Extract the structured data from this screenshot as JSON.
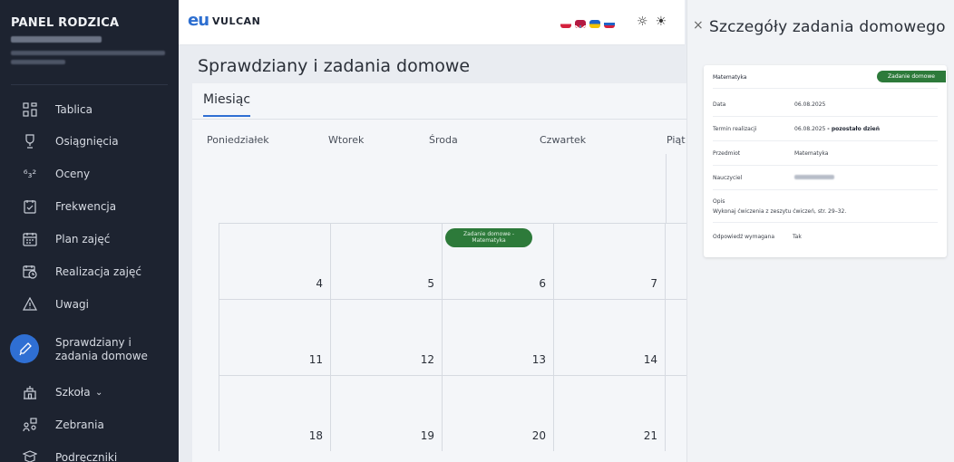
{
  "sidebar": {
    "title": "PANEL RODZICA",
    "items": [
      {
        "label": "Tablica",
        "icon": "dashboard-icon"
      },
      {
        "label": "Osiągnięcia",
        "icon": "trophy-icon"
      },
      {
        "label": "Oceny",
        "icon": "grades-icon"
      },
      {
        "label": "Frekwencja",
        "icon": "attendance-icon"
      },
      {
        "label": "Plan zajęć",
        "icon": "schedule-icon"
      },
      {
        "label": "Realizacja zajęć",
        "icon": "calendar-clock-icon"
      },
      {
        "label": "Uwagi",
        "icon": "warning-icon"
      },
      {
        "label": "Sprawdziany i zadania domowe",
        "icon": "pencil-icon",
        "active": true
      },
      {
        "label": "Szkoła",
        "icon": "school-icon",
        "chevron": "chevron-down-icon"
      },
      {
        "label": "Zebrania",
        "icon": "meeting-icon"
      },
      {
        "label": "Podręczniki",
        "icon": "book-icon"
      }
    ]
  },
  "topbar": {
    "logo_mark": "eu",
    "logo_text": "VULCAN"
  },
  "page": {
    "title": "Sprawdziany i zadania domowe",
    "tab": "Miesiąc",
    "weekdays": [
      "Poniedziałek",
      "Wtorek",
      "Środa",
      "Czwartek",
      "Piąt"
    ]
  },
  "calendar": {
    "rows": [
      [
        "",
        "",
        "",
        "",
        ""
      ],
      [
        "4",
        "5",
        "6",
        "7",
        ""
      ],
      [
        "11",
        "12",
        "13",
        "14",
        ""
      ],
      [
        "18",
        "19",
        "20",
        "21",
        ""
      ]
    ],
    "event": {
      "line1": "Zadanie domowe -",
      "line2": "Matematyka"
    }
  },
  "panel": {
    "close_label": "×",
    "title": "Szczegóły zadania domowego",
    "subject_header": "Matematyka",
    "badge": "Zadanie domowe",
    "rows": [
      {
        "label": "Data",
        "value": "06.08.2025"
      },
      {
        "label": "Termin realizacji",
        "value": "06.08.2025",
        "value_bold": "- pozostało dzień"
      },
      {
        "label": "Przedmiot",
        "value": "Matematyka"
      },
      {
        "label": "Nauczyciel",
        "value": ""
      },
      {
        "label": "Opis",
        "value": "Wykonaj ćwiczenia z zeszytu ćwiczeń, str. 29–32."
      },
      {
        "label": "Odpowiedź wymagana",
        "value": "Tak"
      }
    ]
  },
  "colors": {
    "sidebar_bg": "#1d2330",
    "accent": "#2f6fd3",
    "event_green": "#2d7a3a"
  }
}
